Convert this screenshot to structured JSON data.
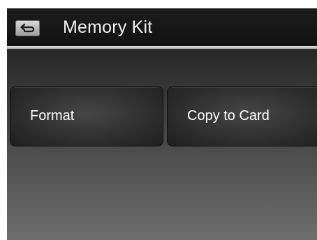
{
  "header": {
    "title": "Memory Kit",
    "back_icon": "back-arrow-icon"
  },
  "options": [
    {
      "label": "Format"
    },
    {
      "label": "Copy to Card"
    }
  ],
  "colors": {
    "title_bar": "#111111",
    "divider": "#d0d0d0",
    "button_face": "#2e2e2e",
    "text": "#ffffff"
  }
}
